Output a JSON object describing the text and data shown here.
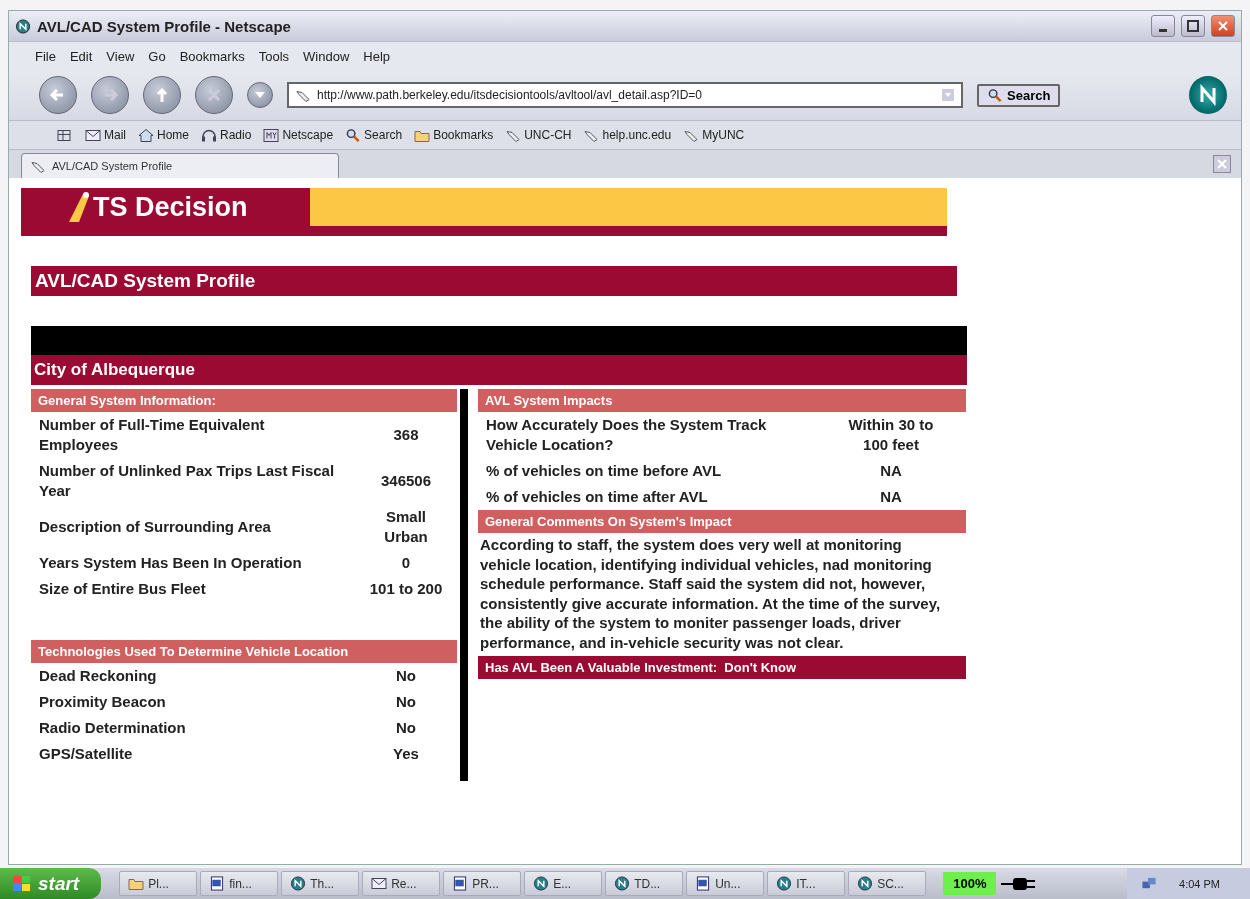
{
  "window": {
    "title": "AVL/CAD System Profile - Netscape"
  },
  "menu": [
    "File",
    "Edit",
    "View",
    "Go",
    "Bookmarks",
    "Tools",
    "Window",
    "Help"
  ],
  "nav_toolbar": {
    "url": "http://www.path.berkeley.edu/itsdecisiontools/avltool/avl_detail.asp?ID=0",
    "search_button": "Search"
  },
  "personal_toolbar": [
    {
      "label": "Mail",
      "kind": "mail"
    },
    {
      "label": "Home",
      "kind": "home"
    },
    {
      "label": "Radio",
      "kind": "radio"
    },
    {
      "label": "Netscape",
      "kind": "my"
    },
    {
      "label": "Search",
      "kind": "search"
    },
    {
      "label": "Bookmarks",
      "kind": "folder"
    },
    {
      "label": "UNC-CH",
      "kind": "link"
    },
    {
      "label": "help.unc.edu",
      "kind": "link"
    },
    {
      "label": "MyUNC",
      "kind": "link"
    }
  ],
  "tabs": [
    {
      "label": "AVL/CAD System Profile",
      "selected": true
    }
  ],
  "page": {
    "logo": "TS Decision",
    "title": "AVL/CAD System Profile",
    "agency": "City of Albequerque",
    "general": {
      "heading": "General System Information:",
      "rows": [
        {
          "label": "Number of Full-Time Equivalent Employees",
          "value": "368"
        },
        {
          "label": "Number of Unlinked Pax Trips Last Fiscal Year",
          "value": "346506"
        },
        {
          "label": "Description of Surrounding Area",
          "value": "Small Urban"
        },
        {
          "label": "Years System Has Been In Operation",
          "value": "0"
        },
        {
          "label": "Size of Entire Bus Fleet",
          "value": "101 to 200"
        }
      ]
    },
    "technologies": {
      "heading": "Technologies Used To Determine Vehicle Location",
      "rows": [
        {
          "label": "Dead Reckoning",
          "value": "No"
        },
        {
          "label": "Proximity Beacon",
          "value": "No"
        },
        {
          "label": "Radio Determination",
          "value": "No"
        },
        {
          "label": "GPS/Satellite",
          "value": "Yes"
        }
      ]
    },
    "impacts": {
      "heading": "AVL System Impacts",
      "rows": [
        {
          "label": "How Accurately Does the System Track Vehicle Location?",
          "value": "Within 30 to 100 feet"
        },
        {
          "label": "% of vehicles on time before AVL",
          "value": "NA"
        },
        {
          "label": "% of vehicles on time after AVL",
          "value": "NA"
        }
      ]
    },
    "comments": {
      "heading": "General Comments On System's Impact",
      "text": "According to staff, the system does very well at monitoring vehicle location, identifying individual vehicles, nad monitoring schedule performance. Staff said the system did not, however, consistently give accurate information. At the time of the survey, the ability of the system to moniter passenger loads, driver performance, and in-vehicle security was not clear."
    },
    "investment": "Has AVL Been A Valuable Investment:  Don't Know"
  },
  "taskbar": {
    "start": "start",
    "items": [
      {
        "label": "Pl...",
        "kind": "folder"
      },
      {
        "label": "fin...",
        "kind": "word"
      },
      {
        "label": "Th...",
        "kind": "netscape"
      },
      {
        "label": "Re...",
        "kind": "mail"
      },
      {
        "label": "PR...",
        "kind": "word"
      },
      {
        "label": "E...",
        "kind": "netscape"
      },
      {
        "label": "TD...",
        "kind": "netscape"
      },
      {
        "label": "Un...",
        "kind": "word"
      },
      {
        "label": "IT...",
        "kind": "netscape"
      },
      {
        "label": "SC...",
        "kind": "netscape"
      }
    ],
    "battery": "100%",
    "clock": "4:04 PM"
  }
}
